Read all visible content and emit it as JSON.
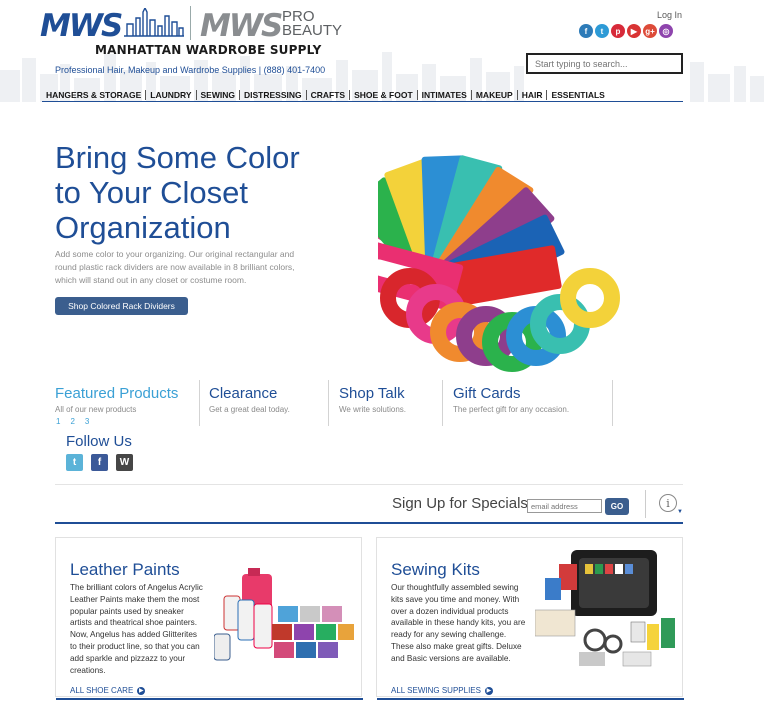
{
  "header": {
    "logo_mws": "MWS",
    "logo_pro_mws": "MWS",
    "logo_pro": "PRO",
    "logo_beauty": "BEAUTY",
    "brand_name": "MANHATTAN WARDROBE SUPPLY",
    "tagline": "Professional Hair, Makeup and Wardrobe Supplies | (888) 401-7400",
    "login": "Log In",
    "search_placeholder": "Start typing to search...",
    "social_icons": [
      "facebook-icon",
      "twitter-icon",
      "pinterest-icon",
      "youtube-icon",
      "google-plus-icon",
      "instagram-icon"
    ],
    "social_colors": [
      "#2d7bb8",
      "#2d9ad6",
      "#d72a3a",
      "#d93434",
      "#dd4b39",
      "#8e44ad"
    ]
  },
  "nav": [
    "HANGERS & STORAGE",
    "LAUNDRY",
    "SEWING",
    "DISTRESSING",
    "CRAFTS",
    "SHOE & FOOT",
    "INTIMATES",
    "MAKEUP",
    "HAIR",
    "ESSENTIALS"
  ],
  "hero": {
    "title_line1": "Bring Some Color",
    "title_line2": "to Your Closet",
    "title_line3": "Organization",
    "text": "Add some color to your organizing. Our original rectangular and round plastic rack dividers are now available in 8 brilliant colors, which will stand out in any closet or costume room.",
    "button": "Shop Colored Rack Dividers"
  },
  "tabs": [
    {
      "title": "Featured Products",
      "subtitle": "All of our new products",
      "active": true
    },
    {
      "title": "Clearance",
      "subtitle": "Get a great deal today."
    },
    {
      "title": "Shop Talk",
      "subtitle": "We write solutions."
    },
    {
      "title": "Gift Cards",
      "subtitle": "The perfect gift for any occasion."
    }
  ],
  "pager": [
    "1",
    "2",
    "3"
  ],
  "follow": {
    "title": "Follow Us",
    "icons": [
      "twitter-icon",
      "facebook-icon",
      "wordpress-icon"
    ]
  },
  "signup": {
    "label": "Sign Up for Specials",
    "placeholder": "email address",
    "button": "GO",
    "info": "i"
  },
  "cards": [
    {
      "title": "Leather Paints",
      "text": "The brilliant colors of Angelus Acrylic Leather Paints make them the most popular paints used by sneaker artists and theatrical shoe painters. Now, Angelus has added Glitterites to their product line, so that you can add sparkle and pizzazz to your creations.",
      "link": "ALL SHOE CARE"
    },
    {
      "title": "Sewing Kits",
      "text": "Our thoughtfully assembled sewing kits save you time and money. With over a dozen individual products available in these handy kits, you are ready for any sewing challenge. These also make great gifts. Deluxe and Basic versions are available.",
      "link": "ALL SEWING SUPPLIES"
    }
  ],
  "colors": {
    "brand_blue": "#1f4e96",
    "accent_blue": "#3aa0d5",
    "button_blue": "#3b5e8e"
  }
}
